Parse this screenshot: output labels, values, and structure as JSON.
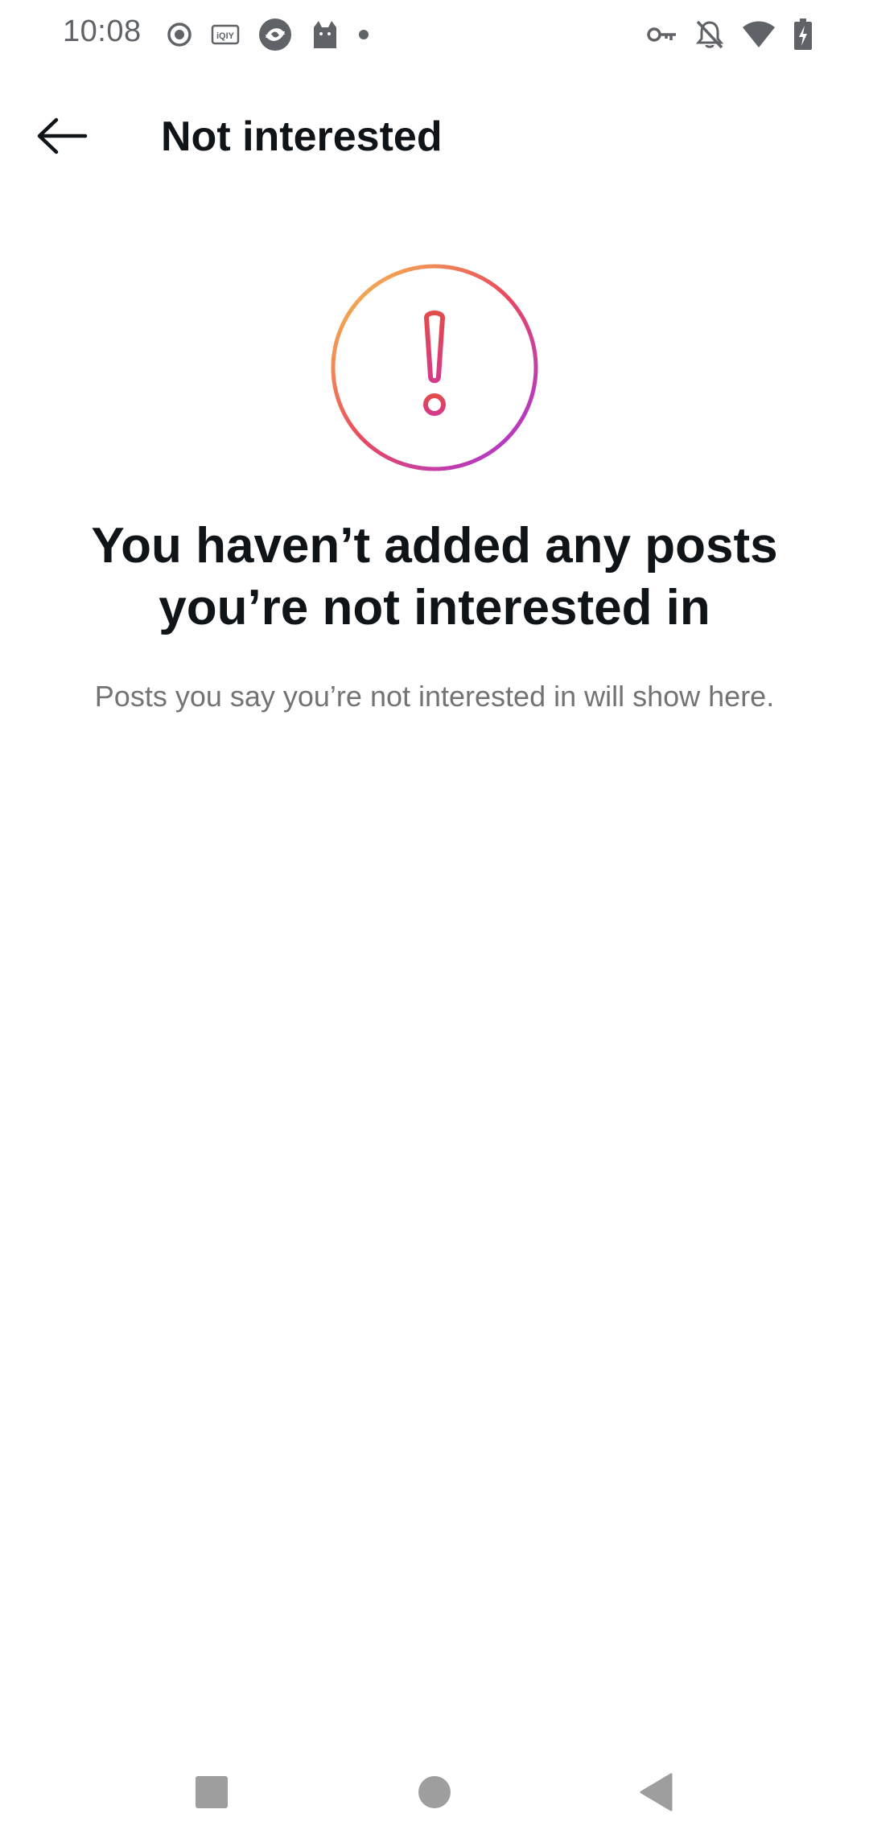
{
  "status_bar": {
    "time": "10:08",
    "left_icons": [
      "record-icon",
      "iqiyi-icon",
      "browser-icon",
      "cat-app-icon",
      "dot-icon"
    ],
    "right_icons": [
      "vpn-key-icon",
      "bell-off-icon",
      "wifi-icon",
      "battery-charging-icon"
    ]
  },
  "app_bar": {
    "back_icon": "arrow-left-icon",
    "title": "Not interested"
  },
  "empty_state": {
    "icon": "exclamation-circle-gradient-icon",
    "title": "You haven’t added any posts you’re not interested in",
    "subtitle": "Posts you say you’re not interested in will show here."
  },
  "colors": {
    "gradient_start": "#F7C84F",
    "gradient_mid": "#E8495F",
    "gradient_end": "#A233E8",
    "title_text": "#0F1419",
    "subtitle_text": "#737373",
    "status_icons": "#5F6368",
    "nav_icons": "#9E9E9E"
  },
  "nav_bar": {
    "recents_icon": "square-icon",
    "home_icon": "circle-icon",
    "back_icon": "triangle-back-icon"
  }
}
